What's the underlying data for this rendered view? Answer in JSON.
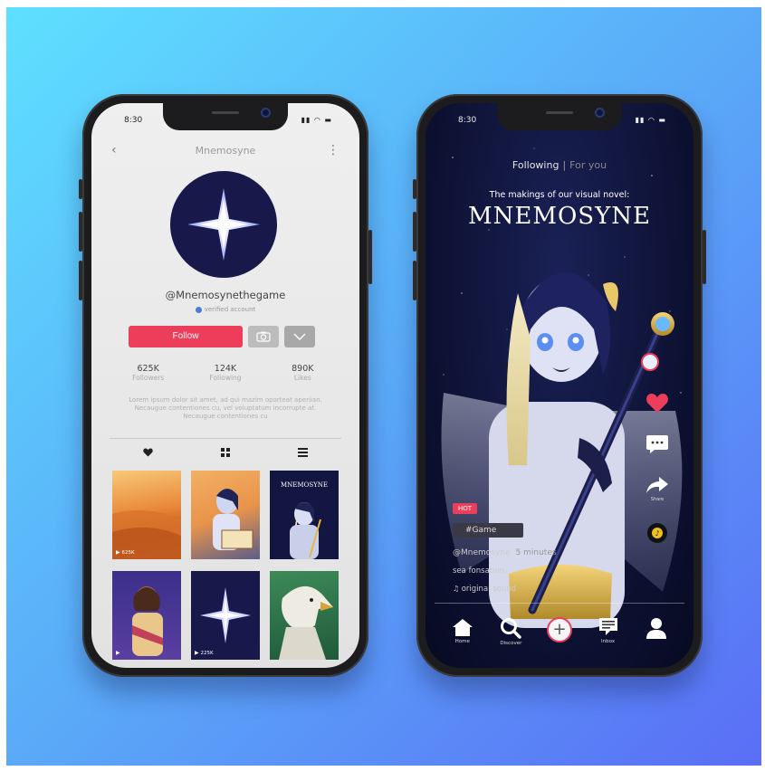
{
  "left_phone": {
    "status_time": "8:30",
    "header_title": "Mnemosyne",
    "handle": "@Mnemosynethegame",
    "verified_text": "verified account",
    "follow_label": "Follow",
    "stats": [
      {
        "num": "625K",
        "label": "Followers"
      },
      {
        "num": "124K",
        "label": "Following"
      },
      {
        "num": "890K",
        "label": "Likes"
      }
    ],
    "bio": "Lorem ipsum dolor sit amet, ad qui mazim oporteat aperiian. Necaugue contentiones cu, vel voluptatum incorrupte at. Necaugue contentiones cu",
    "tabs": [
      "heart-icon",
      "grid-icon",
      "list-icon"
    ],
    "thumb_counts": [
      "625K",
      "",
      "",
      "",
      "225K",
      ""
    ],
    "accent": "#ec3d5b"
  },
  "right_phone": {
    "status_time": "8:30",
    "tab_following": "Following",
    "tab_foryou": "For you",
    "novel_sub": "The makings of our visual novel:",
    "novel_title": "MNEMOSYNE",
    "hot": "HOT",
    "tag": "#Game",
    "user": "@Mnemosyne",
    "ago": "5 minutes",
    "caption": "sea fonsation",
    "sound": "original sound",
    "share_label": "Share",
    "nav": {
      "home": "Home",
      "discover": "Discover",
      "inbox": "Inbox"
    }
  }
}
